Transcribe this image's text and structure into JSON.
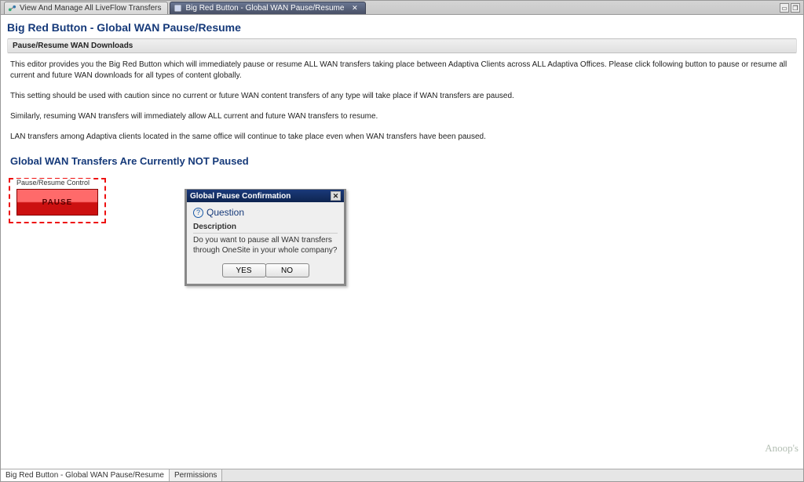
{
  "tabs": {
    "tab1": {
      "label": "View And Manage All LiveFlow Transfers"
    },
    "tab2": {
      "label": "Big Red Button - Global WAN Pause/Resume"
    }
  },
  "page": {
    "title": "Big Red Button - Global WAN Pause/Resume",
    "section_header": "Pause/Resume WAN Downloads",
    "para1": "This editor provides you the Big Red Button which will immediately pause or resume ALL WAN transfers taking place between Adaptiva Clients across ALL Adaptiva Offices. Please click following button to pause or resume all current and future WAN downloads for all types of content globally.",
    "para2": "This setting should be used with caution since no current or future WAN content transfers of any type will take place if WAN transfers are paused.",
    "para3": "Similarly, resuming WAN transfers will immediately allow ALL current and future WAN transfers to resume.",
    "para4": "LAN transfers among Adaptiva clients located in the same office will continue to take place even when WAN transfers have been paused.",
    "status_heading": "Global WAN Transfers Are Currently NOT Paused",
    "fieldset_legend": "Pause/Resume Control",
    "pause_button_label": "PAUSE"
  },
  "dialog": {
    "title": "Global Pause Confirmation",
    "heading": "Question",
    "description_label": "Description",
    "description": "Do you want to pause all WAN transfers through OneSite in your whole company?",
    "yes": "YES",
    "no": "NO"
  },
  "statusbar": {
    "cell1": "Big Red Button - Global WAN Pause/Resume",
    "cell2": "Permissions"
  },
  "watermark": "Anoop's"
}
